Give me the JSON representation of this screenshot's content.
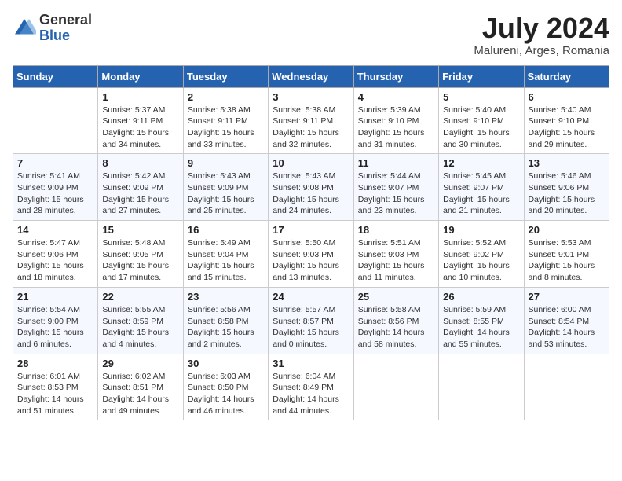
{
  "header": {
    "logo_general": "General",
    "logo_blue": "Blue",
    "month_year": "July 2024",
    "location": "Malureni, Arges, Romania"
  },
  "weekdays": [
    "Sunday",
    "Monday",
    "Tuesday",
    "Wednesday",
    "Thursday",
    "Friday",
    "Saturday"
  ],
  "weeks": [
    [
      {
        "day": "",
        "sunrise": "",
        "sunset": "",
        "daylight": ""
      },
      {
        "day": "1",
        "sunrise": "Sunrise: 5:37 AM",
        "sunset": "Sunset: 9:11 PM",
        "daylight": "Daylight: 15 hours and 34 minutes."
      },
      {
        "day": "2",
        "sunrise": "Sunrise: 5:38 AM",
        "sunset": "Sunset: 9:11 PM",
        "daylight": "Daylight: 15 hours and 33 minutes."
      },
      {
        "day": "3",
        "sunrise": "Sunrise: 5:38 AM",
        "sunset": "Sunset: 9:11 PM",
        "daylight": "Daylight: 15 hours and 32 minutes."
      },
      {
        "day": "4",
        "sunrise": "Sunrise: 5:39 AM",
        "sunset": "Sunset: 9:10 PM",
        "daylight": "Daylight: 15 hours and 31 minutes."
      },
      {
        "day": "5",
        "sunrise": "Sunrise: 5:40 AM",
        "sunset": "Sunset: 9:10 PM",
        "daylight": "Daylight: 15 hours and 30 minutes."
      },
      {
        "day": "6",
        "sunrise": "Sunrise: 5:40 AM",
        "sunset": "Sunset: 9:10 PM",
        "daylight": "Daylight: 15 hours and 29 minutes."
      }
    ],
    [
      {
        "day": "7",
        "sunrise": "Sunrise: 5:41 AM",
        "sunset": "Sunset: 9:09 PM",
        "daylight": "Daylight: 15 hours and 28 minutes."
      },
      {
        "day": "8",
        "sunrise": "Sunrise: 5:42 AM",
        "sunset": "Sunset: 9:09 PM",
        "daylight": "Daylight: 15 hours and 27 minutes."
      },
      {
        "day": "9",
        "sunrise": "Sunrise: 5:43 AM",
        "sunset": "Sunset: 9:09 PM",
        "daylight": "Daylight: 15 hours and 25 minutes."
      },
      {
        "day": "10",
        "sunrise": "Sunrise: 5:43 AM",
        "sunset": "Sunset: 9:08 PM",
        "daylight": "Daylight: 15 hours and 24 minutes."
      },
      {
        "day": "11",
        "sunrise": "Sunrise: 5:44 AM",
        "sunset": "Sunset: 9:07 PM",
        "daylight": "Daylight: 15 hours and 23 minutes."
      },
      {
        "day": "12",
        "sunrise": "Sunrise: 5:45 AM",
        "sunset": "Sunset: 9:07 PM",
        "daylight": "Daylight: 15 hours and 21 minutes."
      },
      {
        "day": "13",
        "sunrise": "Sunrise: 5:46 AM",
        "sunset": "Sunset: 9:06 PM",
        "daylight": "Daylight: 15 hours and 20 minutes."
      }
    ],
    [
      {
        "day": "14",
        "sunrise": "Sunrise: 5:47 AM",
        "sunset": "Sunset: 9:06 PM",
        "daylight": "Daylight: 15 hours and 18 minutes."
      },
      {
        "day": "15",
        "sunrise": "Sunrise: 5:48 AM",
        "sunset": "Sunset: 9:05 PM",
        "daylight": "Daylight: 15 hours and 17 minutes."
      },
      {
        "day": "16",
        "sunrise": "Sunrise: 5:49 AM",
        "sunset": "Sunset: 9:04 PM",
        "daylight": "Daylight: 15 hours and 15 minutes."
      },
      {
        "day": "17",
        "sunrise": "Sunrise: 5:50 AM",
        "sunset": "Sunset: 9:03 PM",
        "daylight": "Daylight: 15 hours and 13 minutes."
      },
      {
        "day": "18",
        "sunrise": "Sunrise: 5:51 AM",
        "sunset": "Sunset: 9:03 PM",
        "daylight": "Daylight: 15 hours and 11 minutes."
      },
      {
        "day": "19",
        "sunrise": "Sunrise: 5:52 AM",
        "sunset": "Sunset: 9:02 PM",
        "daylight": "Daylight: 15 hours and 10 minutes."
      },
      {
        "day": "20",
        "sunrise": "Sunrise: 5:53 AM",
        "sunset": "Sunset: 9:01 PM",
        "daylight": "Daylight: 15 hours and 8 minutes."
      }
    ],
    [
      {
        "day": "21",
        "sunrise": "Sunrise: 5:54 AM",
        "sunset": "Sunset: 9:00 PM",
        "daylight": "Daylight: 15 hours and 6 minutes."
      },
      {
        "day": "22",
        "sunrise": "Sunrise: 5:55 AM",
        "sunset": "Sunset: 8:59 PM",
        "daylight": "Daylight: 15 hours and 4 minutes."
      },
      {
        "day": "23",
        "sunrise": "Sunrise: 5:56 AM",
        "sunset": "Sunset: 8:58 PM",
        "daylight": "Daylight: 15 hours and 2 minutes."
      },
      {
        "day": "24",
        "sunrise": "Sunrise: 5:57 AM",
        "sunset": "Sunset: 8:57 PM",
        "daylight": "Daylight: 15 hours and 0 minutes."
      },
      {
        "day": "25",
        "sunrise": "Sunrise: 5:58 AM",
        "sunset": "Sunset: 8:56 PM",
        "daylight": "Daylight: 14 hours and 58 minutes."
      },
      {
        "day": "26",
        "sunrise": "Sunrise: 5:59 AM",
        "sunset": "Sunset: 8:55 PM",
        "daylight": "Daylight: 14 hours and 55 minutes."
      },
      {
        "day": "27",
        "sunrise": "Sunrise: 6:00 AM",
        "sunset": "Sunset: 8:54 PM",
        "daylight": "Daylight: 14 hours and 53 minutes."
      }
    ],
    [
      {
        "day": "28",
        "sunrise": "Sunrise: 6:01 AM",
        "sunset": "Sunset: 8:53 PM",
        "daylight": "Daylight: 14 hours and 51 minutes."
      },
      {
        "day": "29",
        "sunrise": "Sunrise: 6:02 AM",
        "sunset": "Sunset: 8:51 PM",
        "daylight": "Daylight: 14 hours and 49 minutes."
      },
      {
        "day": "30",
        "sunrise": "Sunrise: 6:03 AM",
        "sunset": "Sunset: 8:50 PM",
        "daylight": "Daylight: 14 hours and 46 minutes."
      },
      {
        "day": "31",
        "sunrise": "Sunrise: 6:04 AM",
        "sunset": "Sunset: 8:49 PM",
        "daylight": "Daylight: 14 hours and 44 minutes."
      },
      {
        "day": "",
        "sunrise": "",
        "sunset": "",
        "daylight": ""
      },
      {
        "day": "",
        "sunrise": "",
        "sunset": "",
        "daylight": ""
      },
      {
        "day": "",
        "sunrise": "",
        "sunset": "",
        "daylight": ""
      }
    ]
  ]
}
